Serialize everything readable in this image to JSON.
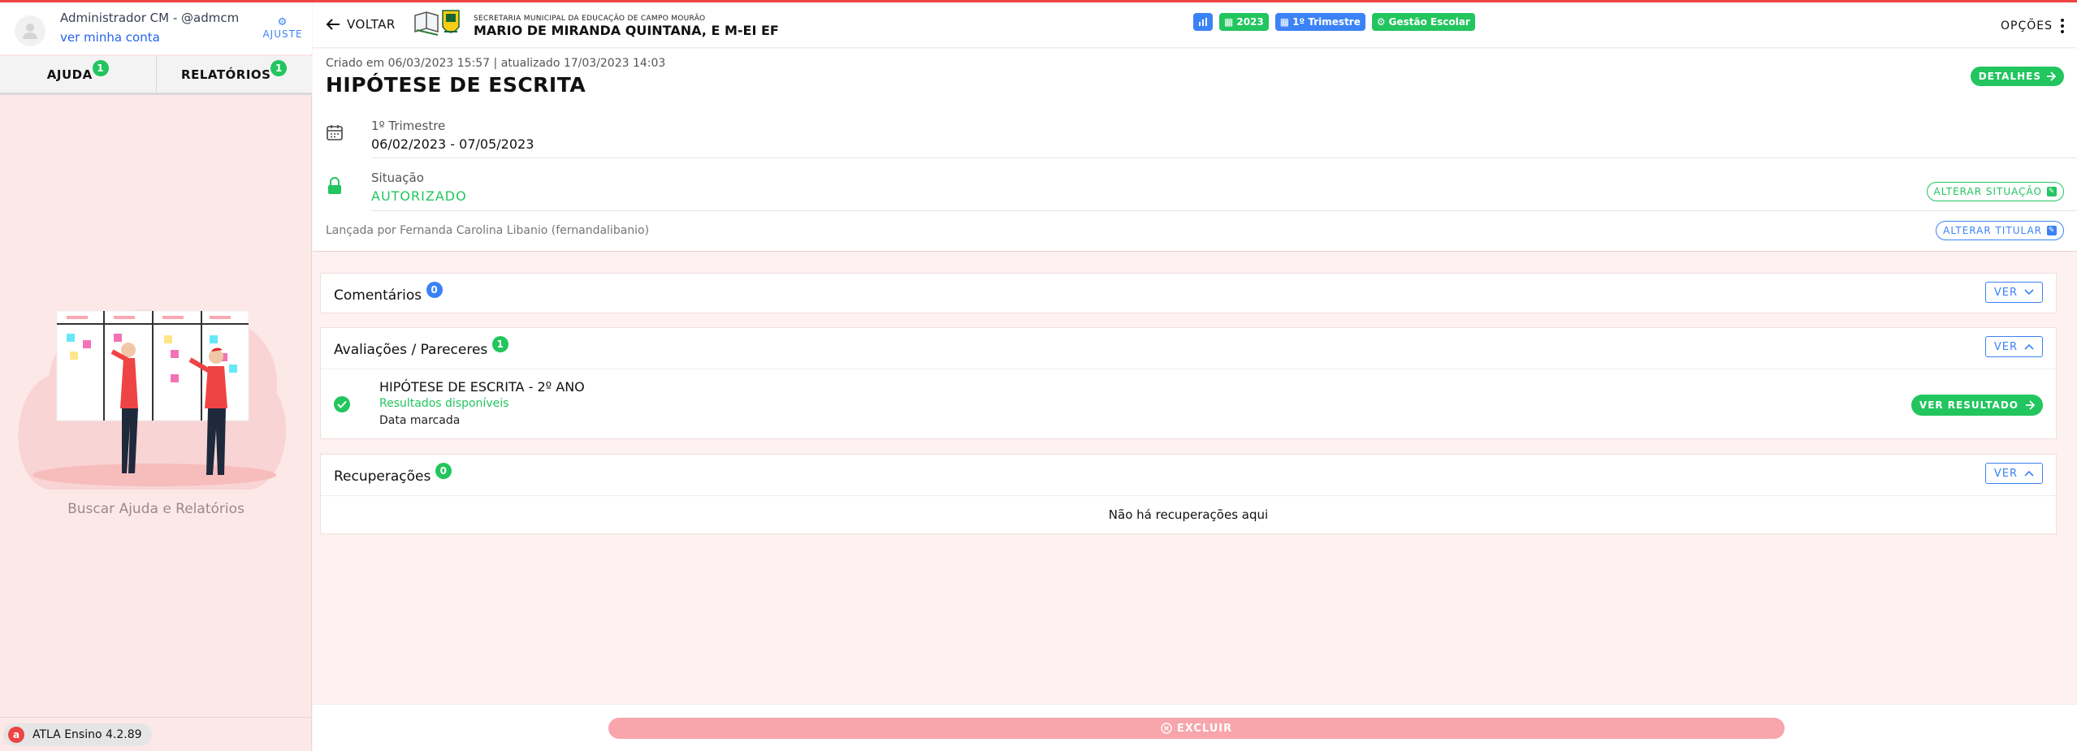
{
  "user": {
    "name": "Administrador CM - @admcm",
    "link": "ver minha conta",
    "settings_label": "AJUSTE"
  },
  "sidebar": {
    "tabs": [
      {
        "label": "AJUDA",
        "count": "1"
      },
      {
        "label": "RELATÓRIOS",
        "count": "1"
      }
    ],
    "help_caption": "Buscar Ajuda e Relatórios",
    "version": "ATLA Ensino 4.2.89"
  },
  "header": {
    "back_label": "VOLTAR",
    "school_subtitle": "SECRETARIA MUNICIPAL DA EDUCAÇÃO DE CAMPO MOURÃO",
    "school_name": "MARIO DE MIRANDA QUINTANA, E M-EI EF",
    "chips": {
      "year": "2023",
      "term": "1º Trimestre",
      "module": "Gestão Escolar"
    },
    "options_label": "OPÇÕES"
  },
  "record": {
    "created": "Criado em 06/03/2023 15:57 | atualizado 17/03/2023 14:03",
    "title": "HIPÓTESE DE ESCRITA",
    "details_label": "DETALHES",
    "period_label": "1º Trimestre",
    "period_value": "06/02/2023 - 07/05/2023",
    "status_label": "Situação",
    "status_value": "AUTORIZADO",
    "change_status_label": "ALTERAR SITUAÇÃO",
    "launched_by": "Lançada por Fernanda Carolina Libanio (fernandalibanio)",
    "change_owner_label": "ALTERAR TITULAR"
  },
  "sections": {
    "comments": {
      "title": "Comentários",
      "count": "0",
      "button": "VER"
    },
    "evaluations": {
      "title": "Avaliações / Pareceres",
      "count": "1",
      "button": "VER",
      "item": {
        "title": "HIPÓTESE DE ESCRITA - 2º ANO",
        "status": "Resultados disponíveis",
        "date": "Data marcada",
        "button": "VER RESULTADO"
      }
    },
    "recoveries": {
      "title": "Recuperações",
      "count": "0",
      "button": "VER",
      "empty": "Não há recuperações aqui"
    }
  },
  "footer": {
    "delete_label": "EXCLUIR"
  },
  "colors": {
    "green": "#22c55e",
    "blue": "#3b82f6",
    "danger": "#f8a5ab",
    "top_line": "#ef4444"
  }
}
